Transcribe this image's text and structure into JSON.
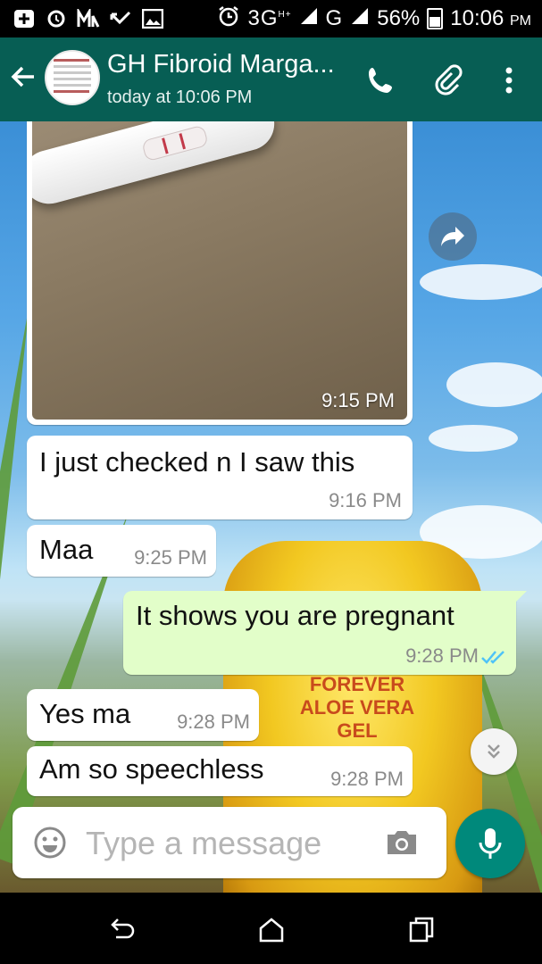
{
  "status_bar": {
    "network": "3G",
    "network_sup": "H+",
    "network2": "G",
    "battery": "56%",
    "time": "10:06",
    "time_suffix": "PM"
  },
  "header": {
    "title": "GH Fibroid Marga...",
    "subtitle": "today at 10:06 PM",
    "back_icon": "arrow-left-icon",
    "call_icon": "phone-icon",
    "attach_icon": "paperclip-icon",
    "menu_icon": "more-vert-icon"
  },
  "messages": [
    {
      "type": "image",
      "direction": "in",
      "time": "9:15 PM"
    },
    {
      "type": "text",
      "direction": "in",
      "text": "I just checked n I saw this",
      "time": "9:16 PM"
    },
    {
      "type": "text",
      "direction": "in",
      "text": "Maa",
      "time": "9:25 PM"
    },
    {
      "type": "text",
      "direction": "out",
      "text": "It shows you are pregnant",
      "time": "9:28 PM",
      "status": "read"
    },
    {
      "type": "text",
      "direction": "in",
      "text": "Yes ma",
      "time": "9:28 PM"
    },
    {
      "type": "text",
      "direction": "in",
      "text": "Am so speechless",
      "time": "9:28 PM"
    }
  ],
  "wallpaper": {
    "text": "FOREVER\nALOE VERA\nGEL"
  },
  "composer": {
    "placeholder": "Type a message",
    "emoji_icon": "emoji-icon",
    "camera_icon": "camera-icon",
    "mic_icon": "mic-icon"
  },
  "colors": {
    "header": "#075e54",
    "outgoing_bubble": "#e2fec9",
    "incoming_bubble": "#ffffff",
    "mic_button": "#00897b",
    "read_ticks": "#4fc3f7"
  }
}
